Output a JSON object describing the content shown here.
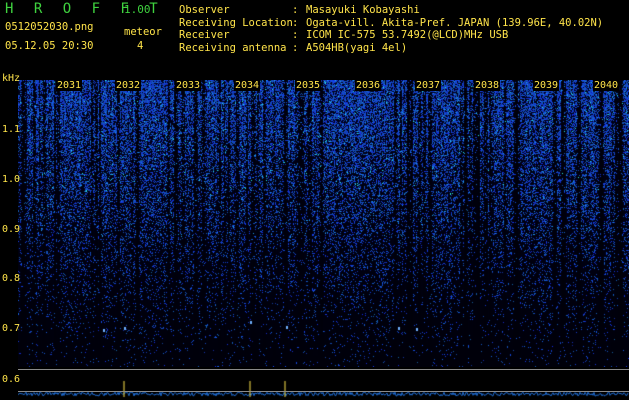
{
  "header": {
    "app_title": "H R O F F T",
    "app_version": "1.00",
    "filename": "0512052030.png",
    "datetime": "05.12.05 20:30",
    "meteor_label": "meteor",
    "meteor_count": "4"
  },
  "station": [
    {
      "key": "Observer",
      "sep": ":",
      "value": "Masayuki Kobayashi"
    },
    {
      "key": "Receiving Location",
      "sep": ":",
      "value": "Ogata-vill. Akita-Pref. JAPAN (139.96E, 40.02N)"
    },
    {
      "key": "Receiver",
      "sep": ":",
      "value": "ICOM IC-575 53.7492(@LCD)MHz USB"
    },
    {
      "key": "Receiving antenna",
      "sep": ":",
      "value": "A504HB(yagi 4el)"
    }
  ],
  "spectrogram": {
    "unit_label": "kHz",
    "y_ticks": [
      "1.1",
      "1.0",
      "0.9",
      "0.8",
      "0.7",
      "0.6"
    ],
    "x_ticks": [
      "2031",
      "2032",
      "2033",
      "2034",
      "2035",
      "2036",
      "2037",
      "2038",
      "2039",
      "2040"
    ]
  },
  "colors": {
    "title_green": "#3fd23f",
    "label_yellow": "#ffe44a",
    "background": "#000000",
    "noise_blue": "#1a3cc8",
    "noise_cyan": "#2ee6e6"
  }
}
